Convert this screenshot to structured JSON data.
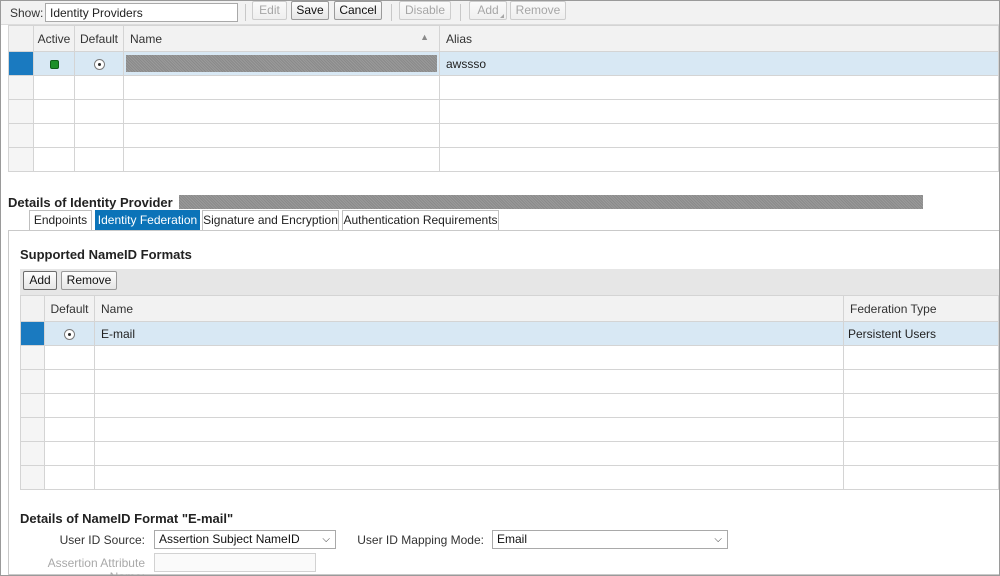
{
  "toolbar": {
    "show_label": "Show:",
    "show_value": "Identity Providers",
    "edit_label": "Edit",
    "save_label": "Save",
    "cancel_label": "Cancel",
    "disable_label": "Disable",
    "add_label": "Add",
    "remove_label": "Remove"
  },
  "providers_table": {
    "columns": {
      "active": "Active",
      "default": "Default",
      "name": "Name",
      "alias": "Alias"
    },
    "rows": [
      {
        "alias": "awssso",
        "active": true,
        "default": true,
        "selected": true
      }
    ]
  },
  "details": {
    "title": "Details of Identity Provider",
    "tabs": [
      "Endpoints",
      "Identity Federation",
      "Signature and Encryption",
      "Authentication Requirements"
    ],
    "active_tab": "Identity Federation"
  },
  "nameid": {
    "section_title": "Supported NameID Formats",
    "add_label": "Add",
    "remove_label": "Remove",
    "columns": {
      "default": "Default",
      "name": "Name",
      "federation_type": "Federation Type"
    },
    "rows": [
      {
        "name": "E-mail",
        "federation_type": "Persistent Users",
        "default": true,
        "selected": true
      }
    ]
  },
  "format_details": {
    "title": "Details of NameID Format \"E-mail\"",
    "user_id_source_label": "User ID Source:",
    "user_id_source_value": "Assertion Subject NameID",
    "user_id_mapping_label": "User ID Mapping Mode:",
    "user_id_mapping_value": "Email",
    "assertion_attr_label": "Assertion Attribute Name:",
    "assertion_attr_value": ""
  },
  "colors": {
    "accent": "#0b73b8",
    "selected_row": "#d8e8f4",
    "active_green": "#1b8f28"
  }
}
